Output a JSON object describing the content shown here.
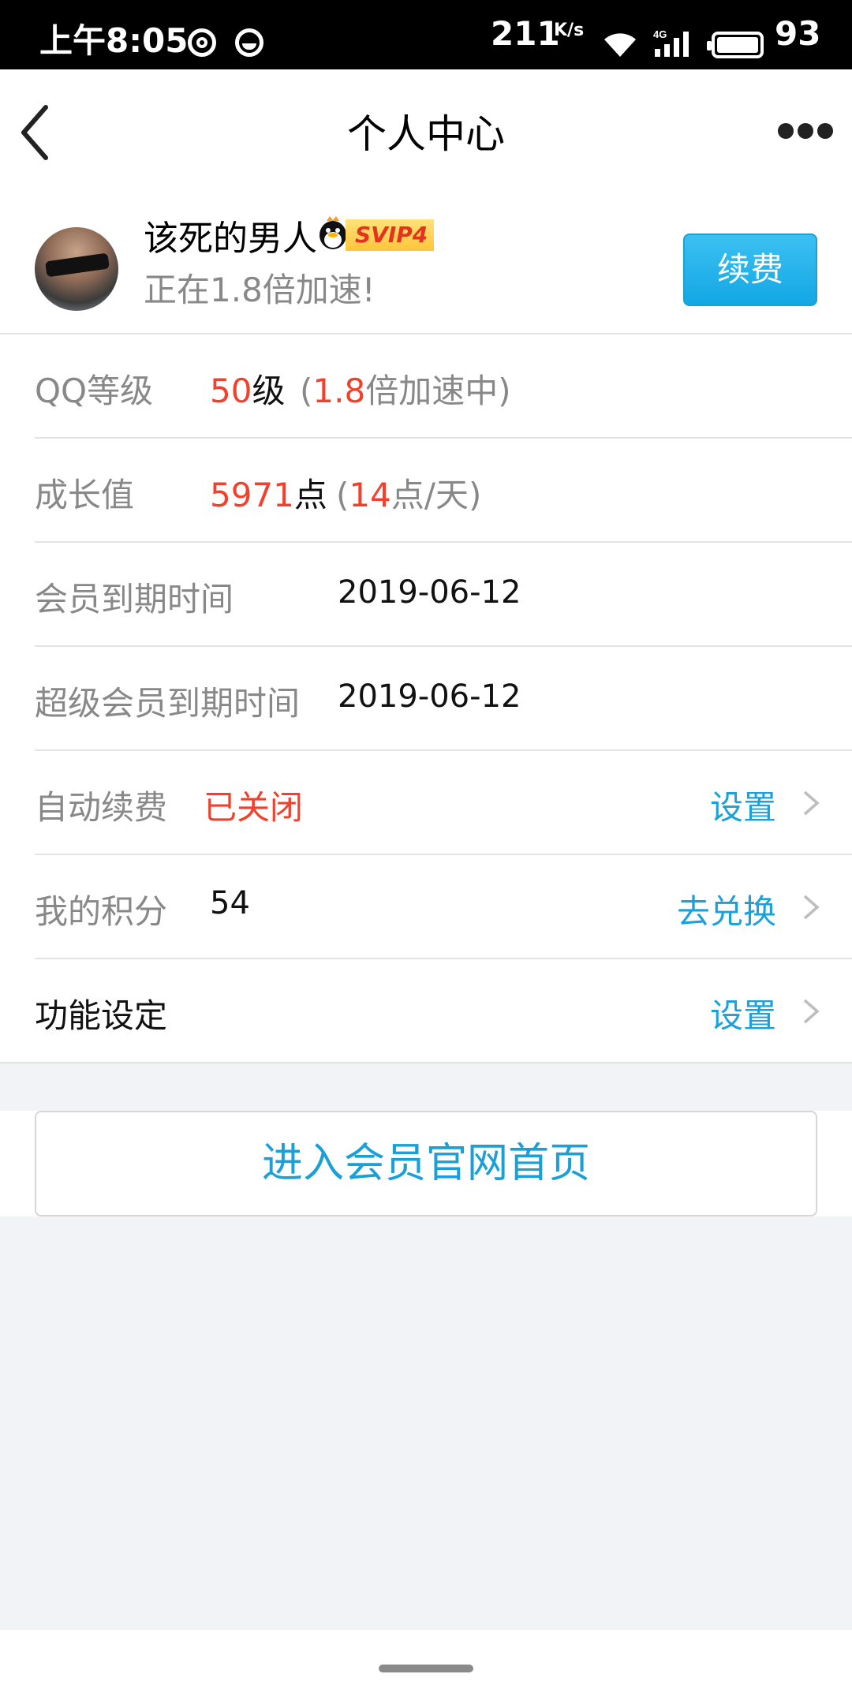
{
  "status_bar": {
    "time": "上午8:05",
    "net_speed": "211",
    "net_speed_unit": "K/s",
    "battery_level": "93",
    "network_type": "4G"
  },
  "nav": {
    "title": "个人中心"
  },
  "profile": {
    "name": "该死的男人",
    "badge": "SVIP4",
    "subtitle": "正在1.8倍加速!",
    "renew_label": "续费"
  },
  "rows": {
    "qq_level": {
      "label": "QQ等级",
      "level_value": "50",
      "level_unit": "级",
      "open_paren": "(",
      "multiplier": "1.8",
      "multiplier_suffix": "倍加速中)"
    },
    "growth": {
      "label": "成长值",
      "points_value": "5971",
      "points_unit": "点",
      "open_paren": "(",
      "daily_value": "14",
      "daily_suffix": "点/天)"
    },
    "member_expiry": {
      "label": "会员到期时间",
      "date": "2019-06-12"
    },
    "svip_expiry": {
      "label": "超级会员到期时间",
      "date": "2019-06-12"
    },
    "auto_renew": {
      "label": "自动续费",
      "status": "已关闭",
      "action": "设置"
    },
    "my_points": {
      "label": "我的积分",
      "value": "54",
      "action": "去兑换"
    },
    "feature_settings": {
      "label": "功能设定",
      "action": "设置"
    }
  },
  "home_button": {
    "label": "进入会员官网首页"
  },
  "colors": {
    "accent_blue": "#1aa1dc",
    "highlight_red": "#f1412c",
    "renew_button": "#12a7e4"
  }
}
